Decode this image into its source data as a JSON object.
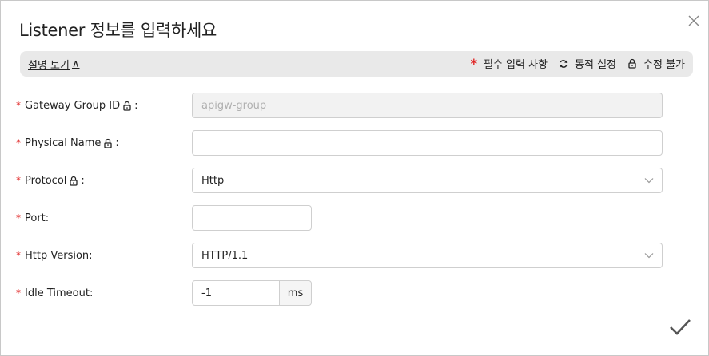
{
  "dialog": {
    "title": "Listener 정보를 입력하세요"
  },
  "info_bar": {
    "toggle_label": "설명 보기",
    "toggle_caret": "∧",
    "required_label": "필수 입력 사항",
    "dynamic_label": "동적 설정",
    "readonly_label": "수정 불가",
    "required_marker": "*"
  },
  "form": {
    "fields": [
      {
        "label": "Gateway Group ID",
        "colon": ":",
        "locked": true,
        "value": "apigw-group",
        "disabled": true
      },
      {
        "label": "Physical Name",
        "colon": ":",
        "locked": true,
        "value": ""
      },
      {
        "label": "Protocol",
        "colon": ":",
        "locked": true,
        "value": "Http"
      },
      {
        "label": "Port",
        "colon": ":",
        "locked": false,
        "value": ""
      },
      {
        "label": "Http Version",
        "colon": ":",
        "locked": false,
        "value": "HTTP/1.1"
      },
      {
        "label": "Idle Timeout",
        "colon": ":",
        "locked": false,
        "value": "-1",
        "unit": "ms"
      }
    ]
  },
  "colors": {
    "required": "#e02020",
    "info_bar_bg": "#e9e9e9",
    "border": "#cfcfcf"
  }
}
